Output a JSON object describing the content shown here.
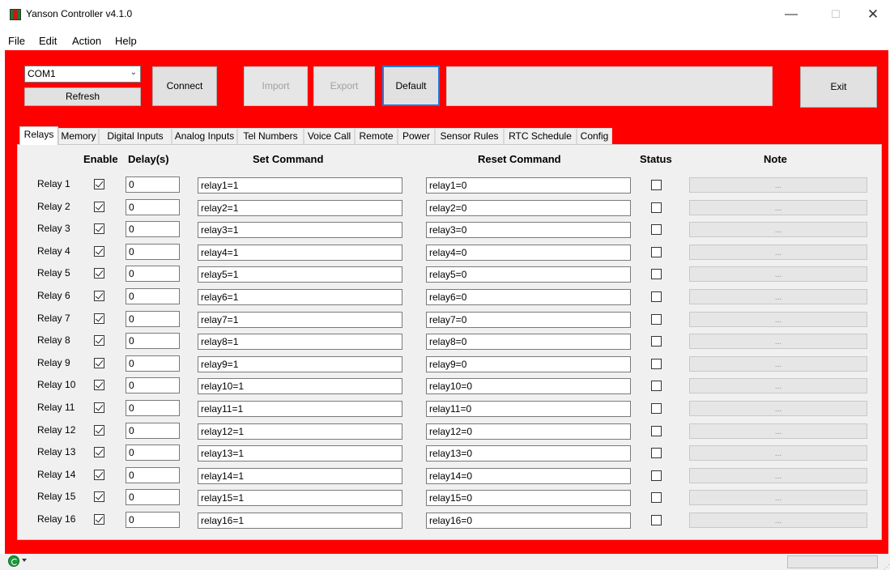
{
  "window": {
    "title": "Yanson Controller v4.1.0",
    "controls": {
      "minimize": "—",
      "maximize": "☐",
      "close": "✕"
    }
  },
  "menu": [
    "File",
    "Edit",
    "Action",
    "Help"
  ],
  "toolbar": {
    "port_value": "COM1",
    "refresh_label": "Refresh",
    "connect_label": "Connect",
    "import_label": "Import",
    "export_label": "Export",
    "default_label": "Default",
    "exit_label": "Exit",
    "status_text": ""
  },
  "tabs": [
    "Relays",
    "Memory",
    "Digital Inputs",
    "Analog Inputs",
    "Tel Numbers",
    "Voice Call",
    "Remote",
    "Power",
    "Sensor Rules",
    "RTC Schedule",
    "Config"
  ],
  "active_tab": "Relays",
  "relays_tab": {
    "headers": {
      "enable": "Enable",
      "delay": "Delay(s)",
      "set_command": "Set Command",
      "reset_command": "Reset Command",
      "status": "Status",
      "note": "Note"
    },
    "rows": [
      {
        "label": "Relay 1",
        "enabled": true,
        "delay": "0",
        "set": "relay1=1",
        "reset": "relay1=0",
        "status": false,
        "note": "..."
      },
      {
        "label": "Relay 2",
        "enabled": true,
        "delay": "0",
        "set": "relay2=1",
        "reset": "relay2=0",
        "status": false,
        "note": "..."
      },
      {
        "label": "Relay 3",
        "enabled": true,
        "delay": "0",
        "set": "relay3=1",
        "reset": "relay3=0",
        "status": false,
        "note": "..."
      },
      {
        "label": "Relay 4",
        "enabled": true,
        "delay": "0",
        "set": "relay4=1",
        "reset": "relay4=0",
        "status": false,
        "note": "..."
      },
      {
        "label": "Relay 5",
        "enabled": true,
        "delay": "0",
        "set": "relay5=1",
        "reset": "relay5=0",
        "status": false,
        "note": "..."
      },
      {
        "label": "Relay 6",
        "enabled": true,
        "delay": "0",
        "set": "relay6=1",
        "reset": "relay6=0",
        "status": false,
        "note": "..."
      },
      {
        "label": "Relay 7",
        "enabled": true,
        "delay": "0",
        "set": "relay7=1",
        "reset": "relay7=0",
        "status": false,
        "note": "..."
      },
      {
        "label": "Relay 8",
        "enabled": true,
        "delay": "0",
        "set": "relay8=1",
        "reset": "relay8=0",
        "status": false,
        "note": "..."
      },
      {
        "label": "Relay 9",
        "enabled": true,
        "delay": "0",
        "set": "relay9=1",
        "reset": "relay9=0",
        "status": false,
        "note": "..."
      },
      {
        "label": "Relay 10",
        "enabled": true,
        "delay": "0",
        "set": "relay10=1",
        "reset": "relay10=0",
        "status": false,
        "note": "..."
      },
      {
        "label": "Relay 11",
        "enabled": true,
        "delay": "0",
        "set": "relay11=1",
        "reset": "relay11=0",
        "status": false,
        "note": "..."
      },
      {
        "label": "Relay 12",
        "enabled": true,
        "delay": "0",
        "set": "relay12=1",
        "reset": "relay12=0",
        "status": false,
        "note": "..."
      },
      {
        "label": "Relay 13",
        "enabled": true,
        "delay": "0",
        "set": "relay13=1",
        "reset": "relay13=0",
        "status": false,
        "note": "..."
      },
      {
        "label": "Relay 14",
        "enabled": true,
        "delay": "0",
        "set": "relay14=1",
        "reset": "relay14=0",
        "status": false,
        "note": "..."
      },
      {
        "label": "Relay 15",
        "enabled": true,
        "delay": "0",
        "set": "relay15=1",
        "reset": "relay15=0",
        "status": false,
        "note": "..."
      },
      {
        "label": "Relay 16",
        "enabled": true,
        "delay": "0",
        "set": "relay16=1",
        "reset": "relay16=0",
        "status": false,
        "note": "..."
      }
    ]
  },
  "colors": {
    "panel_background": "#ff0000",
    "default_button_border": "#2878d8",
    "tab_panel_background": "#f0f0f0"
  },
  "icons": {
    "app": "app-icon",
    "status": "sync-icon"
  }
}
